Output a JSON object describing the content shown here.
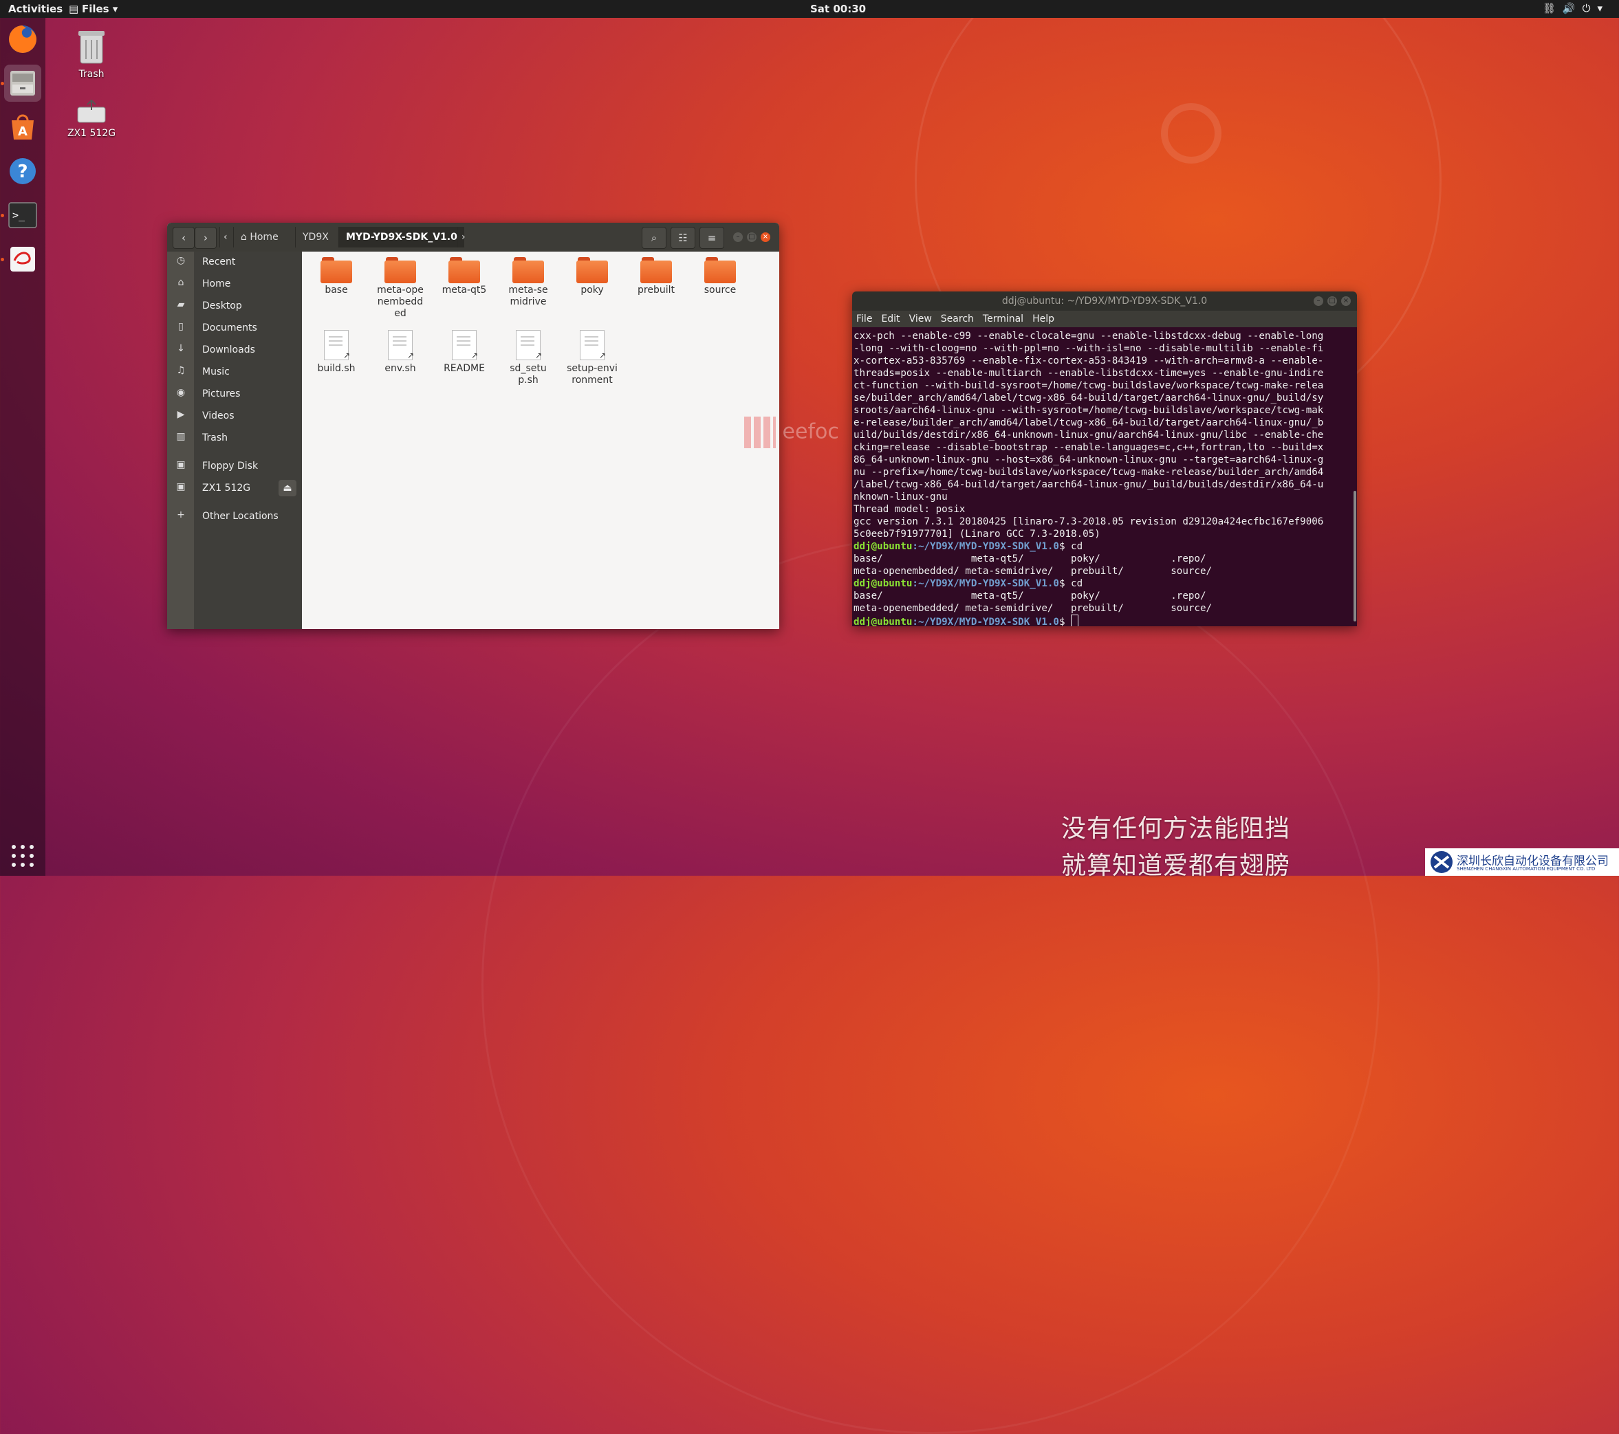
{
  "topbar": {
    "activities": "Activities",
    "app_menu": "Files ▾",
    "clock": "Sat 00:30"
  },
  "desktop": {
    "icons": [
      {
        "label": "Trash"
      },
      {
        "label": "ZX1 512G"
      }
    ]
  },
  "files_window": {
    "breadcrumbs": [
      "Home",
      "YD9X",
      "MYD-YD9X-SDK_V1.0"
    ],
    "sidebar": [
      {
        "label": "Recent",
        "icon": "clock-icon"
      },
      {
        "label": "Home",
        "icon": "home-icon"
      },
      {
        "label": "Desktop",
        "icon": "folder-icon"
      },
      {
        "label": "Documents",
        "icon": "document-icon"
      },
      {
        "label": "Downloads",
        "icon": "download-icon"
      },
      {
        "label": "Music",
        "icon": "music-icon"
      },
      {
        "label": "Pictures",
        "icon": "camera-icon"
      },
      {
        "label": "Videos",
        "icon": "video-icon"
      },
      {
        "label": "Trash",
        "icon": "trash-icon"
      },
      {
        "label": "Floppy Disk",
        "icon": "floppy-icon"
      },
      {
        "label": "ZX1 512G",
        "icon": "drive-icon"
      },
      {
        "label": "Other Locations",
        "icon": "plus-icon"
      }
    ],
    "folders": [
      "base",
      "meta-openembedded",
      "meta-qt5",
      "meta-semidrive",
      "poky",
      "prebuilt",
      "source"
    ],
    "files": [
      "build.sh",
      "env.sh",
      "README",
      "sd_setup.sh",
      "setup-environment"
    ]
  },
  "terminal": {
    "title": "ddj@ubuntu: ~/YD9X/MYD-YD9X-SDK_V1.0",
    "menu": [
      "File",
      "Edit",
      "View",
      "Search",
      "Terminal",
      "Help"
    ],
    "output_lines": [
      "cxx-pch --enable-c99 --enable-clocale=gnu --enable-libstdcxx-debug --enable-long",
      "-long --with-cloog=no --with-ppl=no --with-isl=no --disable-multilib --enable-fi",
      "x-cortex-a53-835769 --enable-fix-cortex-a53-843419 --with-arch=armv8-a --enable-",
      "threads=posix --enable-multiarch --enable-libstdcxx-time=yes --enable-gnu-indire",
      "ct-function --with-build-sysroot=/home/tcwg-buildslave/workspace/tcwg-make-relea",
      "se/builder_arch/amd64/label/tcwg-x86_64-build/target/aarch64-linux-gnu/_build/sy",
      "sroots/aarch64-linux-gnu --with-sysroot=/home/tcwg-buildslave/workspace/tcwg-mak",
      "e-release/builder_arch/amd64/label/tcwg-x86_64-build/target/aarch64-linux-gnu/_b",
      "uild/builds/destdir/x86_64-unknown-linux-gnu/aarch64-linux-gnu/libc --enable-che",
      "cking=release --disable-bootstrap --enable-languages=c,c++,fortran,lto --build=x",
      "86_64-unknown-linux-gnu --host=x86_64-unknown-linux-gnu --target=aarch64-linux-g",
      "nu --prefix=/home/tcwg-buildslave/workspace/tcwg-make-release/builder_arch/amd64",
      "/label/tcwg-x86_64-build/target/aarch64-linux-gnu/_build/builds/destdir/x86_64-u",
      "nknown-linux-gnu",
      "Thread model: posix",
      "gcc version 7.3.1 20180425 [linaro-7.3-2018.05 revision d29120a424ecfbc167ef9006",
      "5c0eeb7f91977701] (Linaro GCC 7.3-2018.05)"
    ],
    "prompt_user": "ddj@ubuntu",
    "prompt_path": ":~/YD9X/MYD-YD9X-SDK_V1.0",
    "cmd": "$ cd",
    "prompt_end": "$ ",
    "ls_lines": [
      "base/               meta-qt5/        poky/            .repo/",
      "meta-openembedded/ meta-semidrive/   prebuilt/        source/"
    ]
  },
  "watermark": {
    "text": "eefoc"
  },
  "subtitles": [
    "没有任何方法能阻挡",
    "就算知道爱都有翅膀"
  ],
  "corner_logo": {
    "cn": "深圳长欣自动化设备有限公司",
    "en": "SHENZHEN CHANGXIN AUTOMATION EQUIPMENT CO. LTD"
  }
}
